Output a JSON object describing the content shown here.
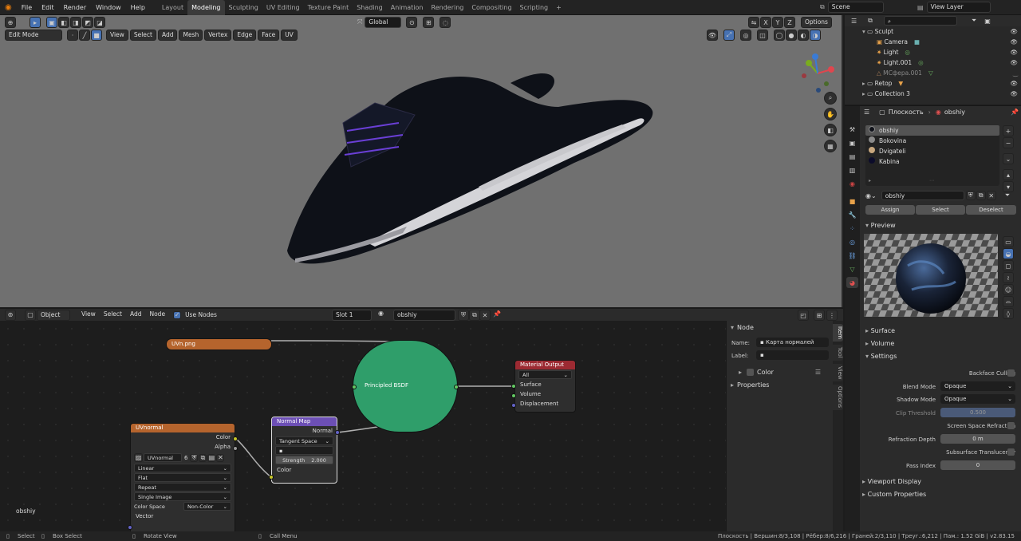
{
  "topbar": {
    "menus": [
      "File",
      "Edit",
      "Render",
      "Window",
      "Help"
    ],
    "workspaces": [
      "Layout",
      "Modeling",
      "Sculpting",
      "UV Editing",
      "Texture Paint",
      "Shading",
      "Animation",
      "Rendering",
      "Compositing",
      "Scripting"
    ],
    "active_workspace": "Modeling",
    "scene": "Scene",
    "view_layer": "View Layer"
  },
  "viewport": {
    "mode": "Edit Mode",
    "menus": [
      "View",
      "Select",
      "Add",
      "Mesh",
      "Vertex",
      "Edge",
      "Face",
      "UV"
    ],
    "transform": "Global",
    "options": "Options",
    "axes": [
      "X",
      "Y",
      "Z"
    ],
    "background_color": "#707070"
  },
  "node_editor": {
    "editor_type": "Object",
    "menus": [
      "View",
      "Select",
      "Add",
      "Node"
    ],
    "use_nodes": "Use Nodes",
    "slot": "Slot 1",
    "material": "obshiy",
    "footer_label": "obshiy",
    "nodes": {
      "uvpng": {
        "title": "UVn.png"
      },
      "principled": {
        "title": "Principled BSDF"
      },
      "material_output": {
        "title": "Material Output",
        "target": "All",
        "inputs": [
          "Surface",
          "Volume",
          "Displacement"
        ]
      },
      "normal_map": {
        "title": "Normal Map",
        "output": "Normal",
        "space": "Tangent Space",
        "strength_label": "Strength",
        "strength_value": "2.000",
        "input": "Color"
      },
      "uvnormal": {
        "title": "UVnormal",
        "outputs": [
          "Color",
          "Alpha"
        ],
        "image": "UVnormal",
        "users": "6",
        "interpolation": "Linear",
        "projection": "Flat",
        "extension": "Repeat",
        "source": "Single Image",
        "color_space_label": "Color Space",
        "color_space": "Non-Color",
        "input": "Vector"
      }
    }
  },
  "npanel": {
    "section": "Node",
    "name_label": "Name:",
    "name_value": "Карта нормалей",
    "label_label": "Label:",
    "label_value": "",
    "color_label": "Color",
    "properties": "Properties",
    "tabs": [
      "Item",
      "Tool",
      "View",
      "Options"
    ]
  },
  "outliner": {
    "search_placeholder": "",
    "items": [
      {
        "name": "Sculpt",
        "indent": 1
      },
      {
        "name": "Camera",
        "indent": 2
      },
      {
        "name": "Light",
        "indent": 2
      },
      {
        "name": "Light.001",
        "indent": 2
      },
      {
        "name": "МСфера.001",
        "indent": 2
      },
      {
        "name": "Retop",
        "indent": 1
      },
      {
        "name": "Collection 3",
        "indent": 1
      }
    ]
  },
  "properties": {
    "object": "Плоскость",
    "material": "obshiy",
    "slots": [
      {
        "name": "obshiy",
        "color": "#10121a"
      },
      {
        "name": "Bokovina",
        "color": "#8a8a8a"
      },
      {
        "name": "Dvigateli",
        "color": "#c8a77e"
      },
      {
        "name": "Kabina",
        "color": "#0c0c2a"
      }
    ],
    "material_field": "obshiy",
    "assign": "Assign",
    "select": "Select",
    "deselect": "Deselect",
    "preview": "Preview",
    "surface": "Surface",
    "volume": "Volume",
    "settings": "Settings",
    "backface_culling": "Backface Culling",
    "blend_mode_label": "Blend Mode",
    "blend_mode": "Opaque",
    "shadow_mode_label": "Shadow Mode",
    "shadow_mode": "Opaque",
    "clip_threshold_label": "Clip Threshold",
    "clip_threshold": "0.500",
    "ssr": "Screen Space Refraction",
    "refraction_depth_label": "Refraction Depth",
    "refraction_depth": "0 m",
    "sss": "Subsurface Translucency",
    "pass_index_label": "Pass Index",
    "pass_index": "0",
    "viewport_display": "Viewport Display",
    "custom_properties": "Custom Properties"
  },
  "status": {
    "select": "Select",
    "box_select": "Box Select",
    "rotate_view": "Rotate View",
    "call_menu": "Call Menu",
    "stats": "Плоскость | Вершин:8/3,108 | Рёбер:8/6,216 | Граней:2/3,110 | Треуг.:6,212 | Пам.: 1.52 GiB | v2.83.15"
  }
}
